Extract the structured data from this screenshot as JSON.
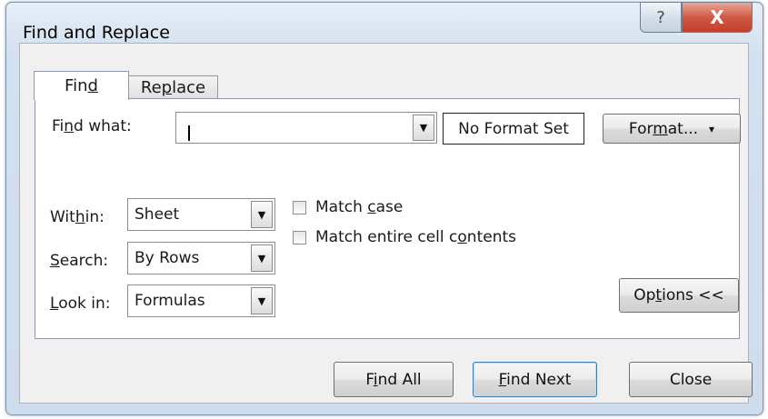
{
  "window": {
    "title": "Find and Replace",
    "help_glyph": "?",
    "close_glyph": "X"
  },
  "tabs": [
    {
      "pre": "Fin",
      "key": "d",
      "post": "",
      "active": true
    },
    {
      "pre": "Re",
      "key": "p",
      "post": "lace",
      "active": false
    }
  ],
  "find_what": {
    "label_pre": "Fi",
    "label_key": "n",
    "label_post": "d what:",
    "value": ""
  },
  "format_status": "No Format Set",
  "format_button": {
    "pre": "For",
    "key": "m",
    "post": "at...",
    "arrow": "▾"
  },
  "within": {
    "label_pre": "Wit",
    "label_key": "h",
    "label_post": "in:",
    "value": "Sheet"
  },
  "search": {
    "label_pre": "",
    "label_key": "S",
    "label_post": "earch:",
    "value": "By Rows"
  },
  "look_in": {
    "label_pre": "",
    "label_key": "L",
    "label_post": "ook in:",
    "value": "Formulas"
  },
  "dropdown_arrow": "▼",
  "match_case": {
    "pre": "Match ",
    "key": "c",
    "post": "ase",
    "checked": false
  },
  "match_entire": {
    "pre": "Match entire cell c",
    "key": "o",
    "post": "ntents",
    "checked": false
  },
  "options_button": {
    "pre": "Op",
    "key": "t",
    "post": "ions <<"
  },
  "find_all_button": {
    "pre": "F",
    "key": "i",
    "post": "nd All"
  },
  "find_next_button": {
    "pre": "",
    "key": "F",
    "post": "ind Next"
  },
  "close_button": {
    "label": "Close"
  }
}
